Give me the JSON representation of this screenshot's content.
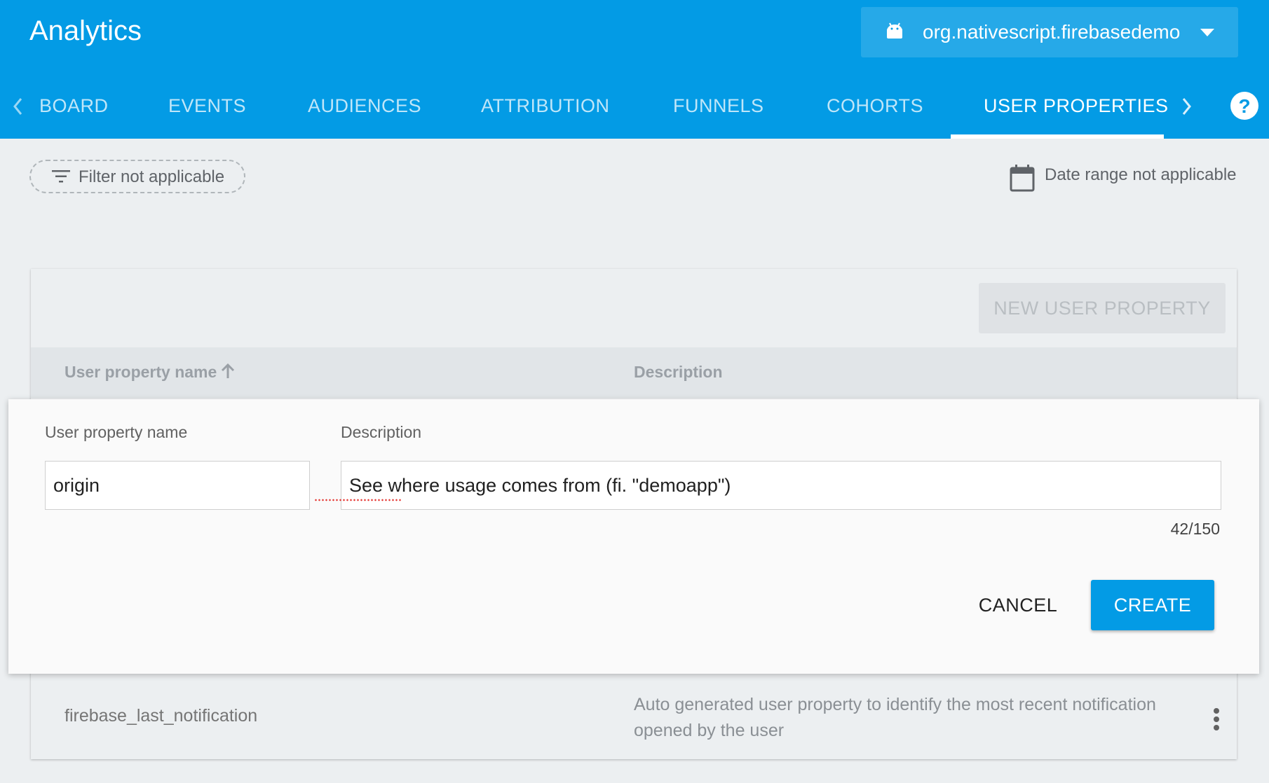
{
  "header": {
    "title": "Analytics",
    "app_selector": {
      "label": "org.nativescript.firebasedemo",
      "icon": "android-icon"
    }
  },
  "tabs": [
    {
      "label": "BOARD",
      "active": false
    },
    {
      "label": "EVENTS",
      "active": false
    },
    {
      "label": "AUDIENCES",
      "active": false
    },
    {
      "label": "ATTRIBUTION",
      "active": false
    },
    {
      "label": "FUNNELS",
      "active": false
    },
    {
      "label": "COHORTS",
      "active": false
    },
    {
      "label": "USER PROPERTIES",
      "active": true
    }
  ],
  "toolbar": {
    "filter_label": "Filter not applicable",
    "date_range_label": "Date range not applicable"
  },
  "card": {
    "new_button_label": "NEW USER PROPERTY",
    "columns": {
      "name": "User property name",
      "description": "Description"
    },
    "rows": [
      {
        "name": "firebase_last_notification",
        "description": "Auto generated user property to identify the most recent notification opened by the user"
      }
    ]
  },
  "editor": {
    "name_label": "User property name",
    "name_value": "origin",
    "description_label": "Description",
    "description_value": "See where usage comes from (fi. \"demoapp\")",
    "char_count": "42/150",
    "cancel_label": "CANCEL",
    "create_label": "CREATE"
  },
  "colors": {
    "brand": "#039be5",
    "background": "#eceff1"
  }
}
